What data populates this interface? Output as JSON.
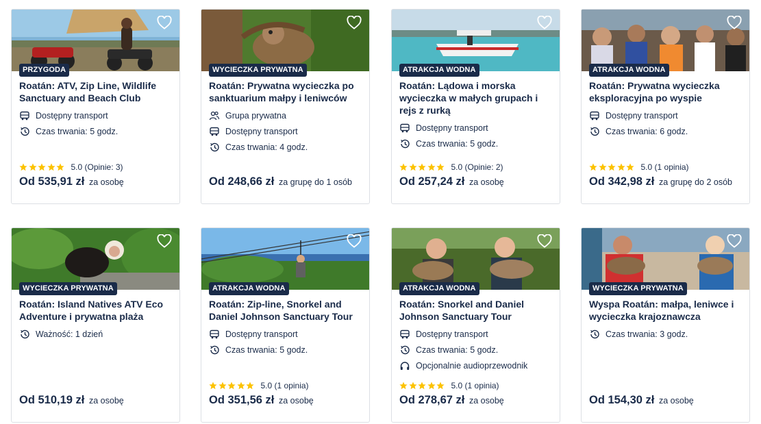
{
  "colors": {
    "navy": "#1a2b49",
    "star": "#fcc200",
    "border": "#dcdfe4"
  },
  "cards": [
    {
      "badge": "PRZYGODA",
      "title": "Roatán: ATV, Zip Line, Wildlife Sanctuary and Beach Club",
      "features": [
        {
          "icon": "bus-icon",
          "text": "Dostępny transport"
        },
        {
          "icon": "duration-icon",
          "text": "Czas trwania: 5 godz."
        }
      ],
      "rating": "5.0 (Opinie: 3)",
      "stars": 5,
      "price": "Od 535,91 zł",
      "price_suffix": "za osobę"
    },
    {
      "badge": "WYCIECZKA PRYWATNA",
      "title": "Roatán: Prywatna wycieczka po sanktuarium małpy i leniwców",
      "features": [
        {
          "icon": "group-icon",
          "text": "Grupa prywatna"
        },
        {
          "icon": "bus-icon",
          "text": "Dostępny transport"
        },
        {
          "icon": "duration-icon",
          "text": "Czas trwania: 4 godz."
        }
      ],
      "rating": "",
      "stars": 0,
      "price": "Od 248,66 zł",
      "price_suffix": "za grupę do 1 osób"
    },
    {
      "badge": "ATRAKCJA WODNA",
      "title": "Roatán: Lądowa i morska wycieczka w małych grupach i rejs z rurką",
      "features": [
        {
          "icon": "bus-icon",
          "text": "Dostępny transport"
        },
        {
          "icon": "duration-icon",
          "text": "Czas trwania: 5 godz."
        }
      ],
      "rating": "5.0 (Opinie: 2)",
      "stars": 5,
      "price": "Od 257,24 zł",
      "price_suffix": "za osobę"
    },
    {
      "badge": "ATRAKCJA WODNA",
      "title": "Roatán: Prywatna wycieczka eksploracyjna po wyspie",
      "features": [
        {
          "icon": "bus-icon",
          "text": "Dostępny transport"
        },
        {
          "icon": "duration-icon",
          "text": "Czas trwania: 6 godz."
        }
      ],
      "rating": "5.0 (1 opinia)",
      "stars": 5,
      "price": "Od 342,98 zł",
      "price_suffix": "za grupę do 2 osób"
    },
    {
      "badge": "WYCIECZKA PRYWATNA",
      "title": "Roatán: Island Natives ATV Eco Adventure i prywatna plaża",
      "features": [
        {
          "icon": "duration-icon",
          "text": "Ważność: 1 dzień"
        }
      ],
      "rating": "",
      "stars": 0,
      "price": "Od 510,19 zł",
      "price_suffix": "za osobę"
    },
    {
      "badge": "ATRAKCJA WODNA",
      "title": "Roatán: Zip-line, Snorkel and Daniel Johnson Sanctuary Tour",
      "features": [
        {
          "icon": "bus-icon",
          "text": "Dostępny transport"
        },
        {
          "icon": "duration-icon",
          "text": "Czas trwania: 5 godz."
        }
      ],
      "rating": "5.0 (1 opinia)",
      "stars": 5,
      "price": "Od 351,56 zł",
      "price_suffix": "za osobę"
    },
    {
      "badge": "ATRAKCJA WODNA",
      "title": "Roatán: Snorkel and Daniel Johnson Sanctuary Tour",
      "features": [
        {
          "icon": "bus-icon",
          "text": "Dostępny transport"
        },
        {
          "icon": "duration-icon",
          "text": "Czas trwania: 5 godz."
        },
        {
          "icon": "headphones-icon",
          "text": "Opcjonalnie audioprzewodnik"
        }
      ],
      "rating": "5.0 (1 opinia)",
      "stars": 5,
      "price": "Od 278,67 zł",
      "price_suffix": "za osobę"
    },
    {
      "badge": "WYCIECZKA PRYWATNA",
      "title": "Wyspa Roatán: małpa, leniwce i wycieczka krajoznawcza",
      "features": [
        {
          "icon": "duration-icon",
          "text": "Czas trwania: 3 godz."
        }
      ],
      "rating": "",
      "stars": 0,
      "price": "Od 154,30 zł",
      "price_suffix": "za osobę"
    }
  ]
}
